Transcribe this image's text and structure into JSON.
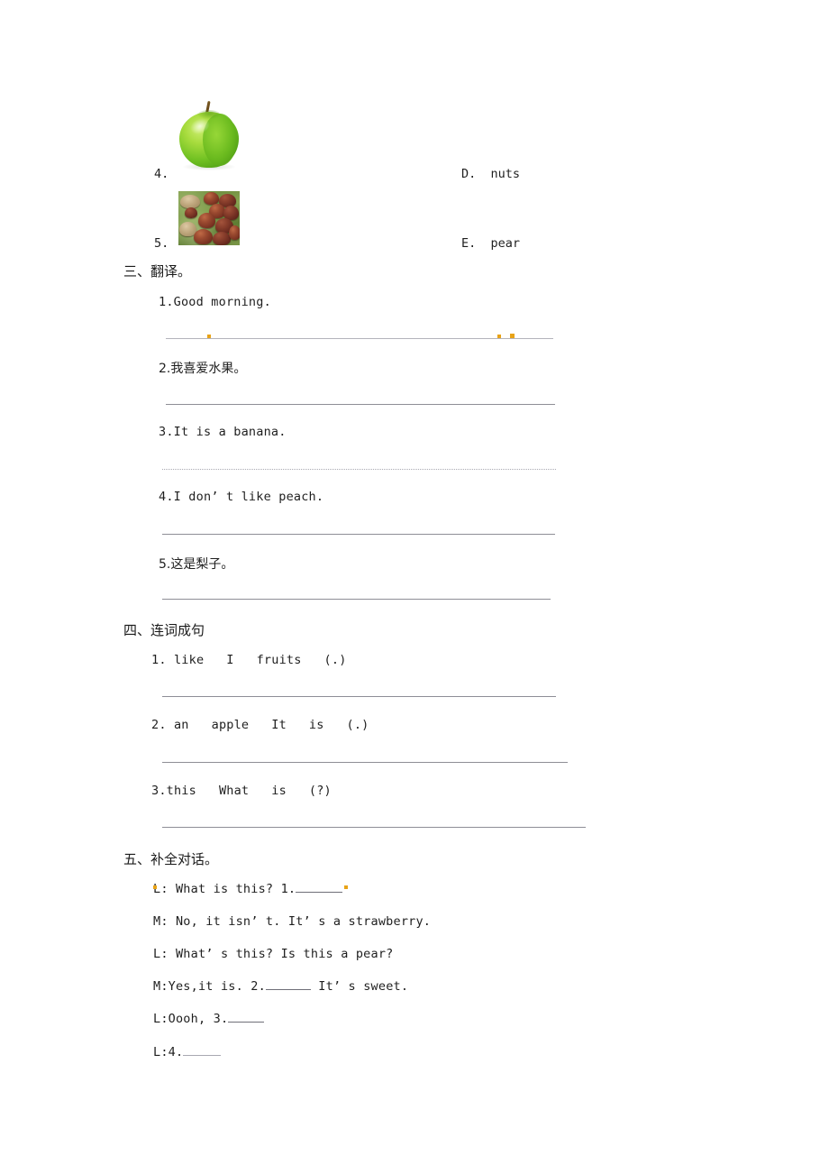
{
  "document": {
    "type": "worksheet",
    "language": "zh-CN + en",
    "page_background": "#ffffff"
  },
  "matching": {
    "items": [
      {
        "number": "4.",
        "image": "green-apple-photo",
        "alt": "green apple"
      },
      {
        "number": "5.",
        "image": "chestnuts-photo",
        "alt": "chestnuts on green leaves"
      }
    ],
    "options": [
      {
        "letter": "D.",
        "word": "nuts",
        "text": "D.  nuts"
      },
      {
        "letter": "E.",
        "word": "pear",
        "text": "E.  pear"
      }
    ]
  },
  "section_three": {
    "heading": "三、翻译。",
    "items": [
      {
        "number": "1.",
        "text": "1.Good morning."
      },
      {
        "number": "2.",
        "text": "2.我喜爱水果。"
      },
      {
        "number": "3.",
        "text": "3.It is a banana."
      },
      {
        "number": "4.",
        "text": "4.I don’ t like peach."
      },
      {
        "number": "5.",
        "text": "5.这是梨子。"
      }
    ]
  },
  "section_four": {
    "heading": "四、连词成句",
    "items": [
      {
        "number": "1.",
        "text": "1. like   I   fruits   (.)"
      },
      {
        "number": "2.",
        "text": "2. an   apple   It   is   (.)"
      },
      {
        "number": "3.",
        "text": "3.this   What   is   (?)"
      }
    ]
  },
  "section_five": {
    "heading": "五、补全对话。",
    "lines": [
      {
        "speaker": "L",
        "before": "L: What is this? 1.",
        "blank": true,
        "after": ""
      },
      {
        "speaker": "M",
        "before": "M: No, it isn’ t. It’ s a strawberry.",
        "blank": false,
        "after": ""
      },
      {
        "speaker": "L",
        "before": "L: What’ s this? Is this a pear?",
        "blank": false,
        "after": ""
      },
      {
        "speaker": "M",
        "before": "M:Yes,it is. 2.",
        "blank": true,
        "after": " It’ s sweet."
      },
      {
        "speaker": "L",
        "before": "L:Oooh, 3.",
        "blank": true,
        "after": ""
      },
      {
        "speaker": "L",
        "before": "L:4.",
        "blank": true,
        "after": ""
      }
    ]
  },
  "colors": {
    "text": "#1f1f1f",
    "rule": "#8e8e96",
    "artifact": "#e8a317",
    "apple_green": "#72c223",
    "nut_brown": "#8a3f2c"
  }
}
